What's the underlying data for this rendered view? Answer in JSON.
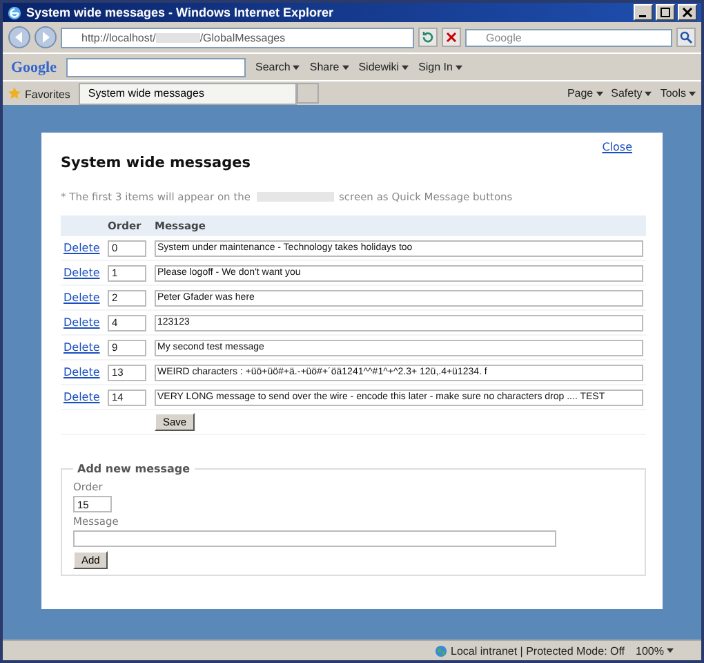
{
  "window": {
    "title": "System wide messages - Windows Internet Explorer"
  },
  "address_bar": {
    "url_start": "http://localhost/",
    "url_end": "/GlobalMessages",
    "search_placeholder": "Google"
  },
  "google_toolbar": {
    "logo": "Google",
    "items": [
      "Search",
      "Share",
      "Sidewiki",
      "Sign In"
    ]
  },
  "favorites_bar": {
    "favorites": "Favorites",
    "tab": "System wide messages",
    "commands": [
      "Page",
      "Safety",
      "Tools"
    ]
  },
  "dialog": {
    "title": "System wide messages",
    "close": "Close",
    "note_start": "* The first 3 items will appear on the",
    "note_end": "screen as Quick Message buttons",
    "columns": [
      "Order",
      "Message"
    ],
    "rows": [
      {
        "action": "Delete",
        "order": "0",
        "message": "System under maintenance - Technology takes holidays too"
      },
      {
        "action": "Delete",
        "order": "1",
        "message": "Please logoff - We don't want you"
      },
      {
        "action": "Delete",
        "order": "2",
        "message": "Peter Gfader was here"
      },
      {
        "action": "Delete",
        "order": "4",
        "message": "123123"
      },
      {
        "action": "Delete",
        "order": "9",
        "message": "My second test message"
      },
      {
        "action": "Delete",
        "order": "13",
        "message": "WEIRD characters : +üö+üö#+ä.-+üö#+´öä1241^^#1^+^2.3+ 12ü,.4+ü1234. f"
      },
      {
        "action": "Delete",
        "order": "14",
        "message": "VERY LONG message to send over the wire - encode this later - make sure no characters drop .... TEST"
      }
    ],
    "save": "Save",
    "add": {
      "legend": "Add new message",
      "order_label": "Order",
      "order_value": "15",
      "message_label": "Message",
      "button": "Add"
    }
  },
  "status_bar": {
    "zone": "Local intranet | Protected Mode: Off",
    "zoom": "100%"
  }
}
